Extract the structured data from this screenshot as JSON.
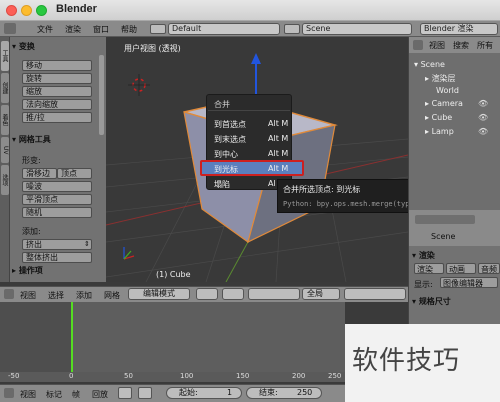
{
  "window": {
    "title": "Blender"
  },
  "info_header": {
    "menus": [
      "文件",
      "渲染",
      "窗口",
      "帮助"
    ],
    "layout": "Default",
    "scene": "Scene",
    "engine": "Blender 渲染"
  },
  "tool_shelf": {
    "tabs": [
      "工具",
      "创建",
      "着色",
      "UV",
      "选项"
    ],
    "transform_header": "变换",
    "transform_buttons": [
      "移动",
      "旋转",
      "缩放",
      "法向缩放",
      "推/拉"
    ],
    "mesh_tools_header": "网格工具",
    "deform_label": "形变:",
    "deform_buttons": [
      "滑移边",
      "顶点",
      "噪波",
      "平滑顶点",
      "随机"
    ],
    "add_label": "添加:",
    "add_buttons": [
      "挤出",
      "整体挤出"
    ],
    "operator_header": "操作项"
  },
  "viewport": {
    "title": "用户视图 (透视)",
    "object_label": "(1) Cube"
  },
  "merge_menu": {
    "title": "合并",
    "items": [
      {
        "label": "到首选点",
        "shortcut": "Alt M"
      },
      {
        "label": "到末选点",
        "shortcut": "Alt M"
      },
      {
        "label": "到中心",
        "shortcut": "Alt M"
      },
      {
        "label": "到光标",
        "shortcut": "Alt M"
      },
      {
        "label": "塌陷",
        "shortcut": "Al"
      }
    ],
    "highlighted_index": 3
  },
  "tooltip": {
    "line1": "合并所选顶点: 到光标",
    "line2": "Python: bpy.ops.mesh.merge(type='CURSOR')"
  },
  "outliner": {
    "header_labels": [
      "视图",
      "搜索",
      "所有"
    ],
    "items": [
      {
        "label": "Scene",
        "indent": 0
      },
      {
        "label": "渲染层",
        "indent": 1
      },
      {
        "label": "World",
        "indent": 1
      },
      {
        "label": "Camera",
        "indent": 1
      },
      {
        "label": "Cube",
        "indent": 1
      },
      {
        "label": "Lamp",
        "indent": 1
      }
    ]
  },
  "properties": {
    "scene_label": "Scene",
    "render_header": "渲染",
    "tabs": [
      "渲染",
      "动画",
      "音频"
    ],
    "display_label": "显示:",
    "display_value": "图像编辑器",
    "dimensions_header": "规格尺寸"
  },
  "view3d_header": {
    "menus": [
      "视图",
      "选择",
      "添加",
      "网格"
    ],
    "mode": "编辑模式",
    "global": "全局"
  },
  "timeline": {
    "ruler_ticks": [
      "-50",
      "0",
      "50",
      "100",
      "150",
      "200",
      "250"
    ],
    "menus": [
      "视图",
      "标记",
      "帧",
      "回放"
    ],
    "start_label": "起始:",
    "start_value": "1",
    "end_label": "结束:",
    "end_value": "250"
  },
  "watermark": "软件技巧",
  "colors": {
    "highlight": "#5b7fbd",
    "red_box": "#cc2020",
    "axis_blue": "#2255dd",
    "axis_red": "#cc2222",
    "axis_green": "#44aa22",
    "frame_line": "#55dd22",
    "cube_edge": "#e08a3a"
  }
}
